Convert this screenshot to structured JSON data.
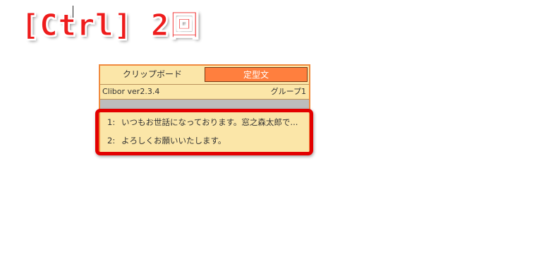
{
  "heading": "[Ctrl] 2回",
  "colors": {
    "heading": "#ee1c1c",
    "active_tab": "#ff7f3e",
    "window_bg": "#fbe6a8",
    "window_border": "#f08a3e",
    "highlight_box": "#e30000"
  },
  "clibor": {
    "tabs": [
      {
        "label": "クリップボード",
        "active": false
      },
      {
        "label": "定型文",
        "active": true
      }
    ],
    "version": "Clibor ver2.3.4",
    "group": "グループ1",
    "items": [
      {
        "num": "1:",
        "text": "いつもお世話になっております。窓之森太郎で..."
      },
      {
        "num": "2:",
        "text": "よろしくお願いいたします。"
      }
    ]
  }
}
